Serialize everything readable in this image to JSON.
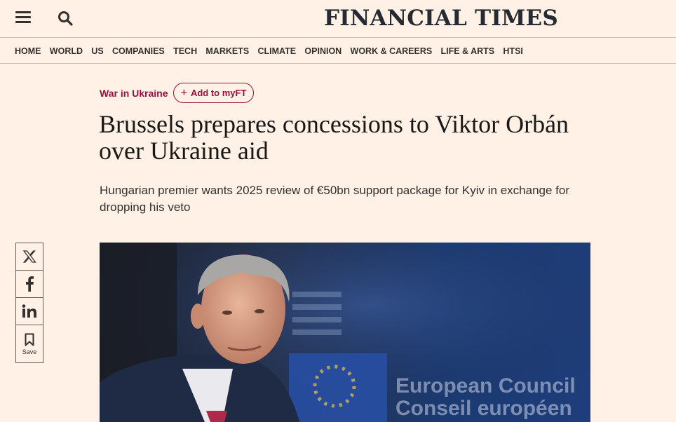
{
  "header": {
    "masthead": "FINANCIAL TIMES"
  },
  "nav": {
    "items": [
      "HOME",
      "WORLD",
      "US",
      "COMPANIES",
      "TECH",
      "MARKETS",
      "CLIMATE",
      "OPINION",
      "WORK & CAREERS",
      "LIFE & ARTS",
      "HTSI"
    ]
  },
  "article": {
    "topic": "War in Ukraine",
    "myft_label": "Add to myFT",
    "headline_line1": "Brussels prepares concessions to Viktor Orbán",
    "headline_line2": "over Ukraine aid",
    "standfirst": "Hungarian premier wants 2025 review of €50bn support package for Kyiv in exchange for dropping his veto"
  },
  "share": {
    "items": [
      "x-icon",
      "facebook-icon",
      "linkedin-icon",
      "bookmark-icon"
    ],
    "save_label": "Save"
  },
  "hero": {
    "backdrop_text_line1": "European Council",
    "backdrop_text_line2": "Conseil européen"
  },
  "colors": {
    "background": "#fff1e5",
    "accent": "#990f3d",
    "text": "#33302e"
  }
}
